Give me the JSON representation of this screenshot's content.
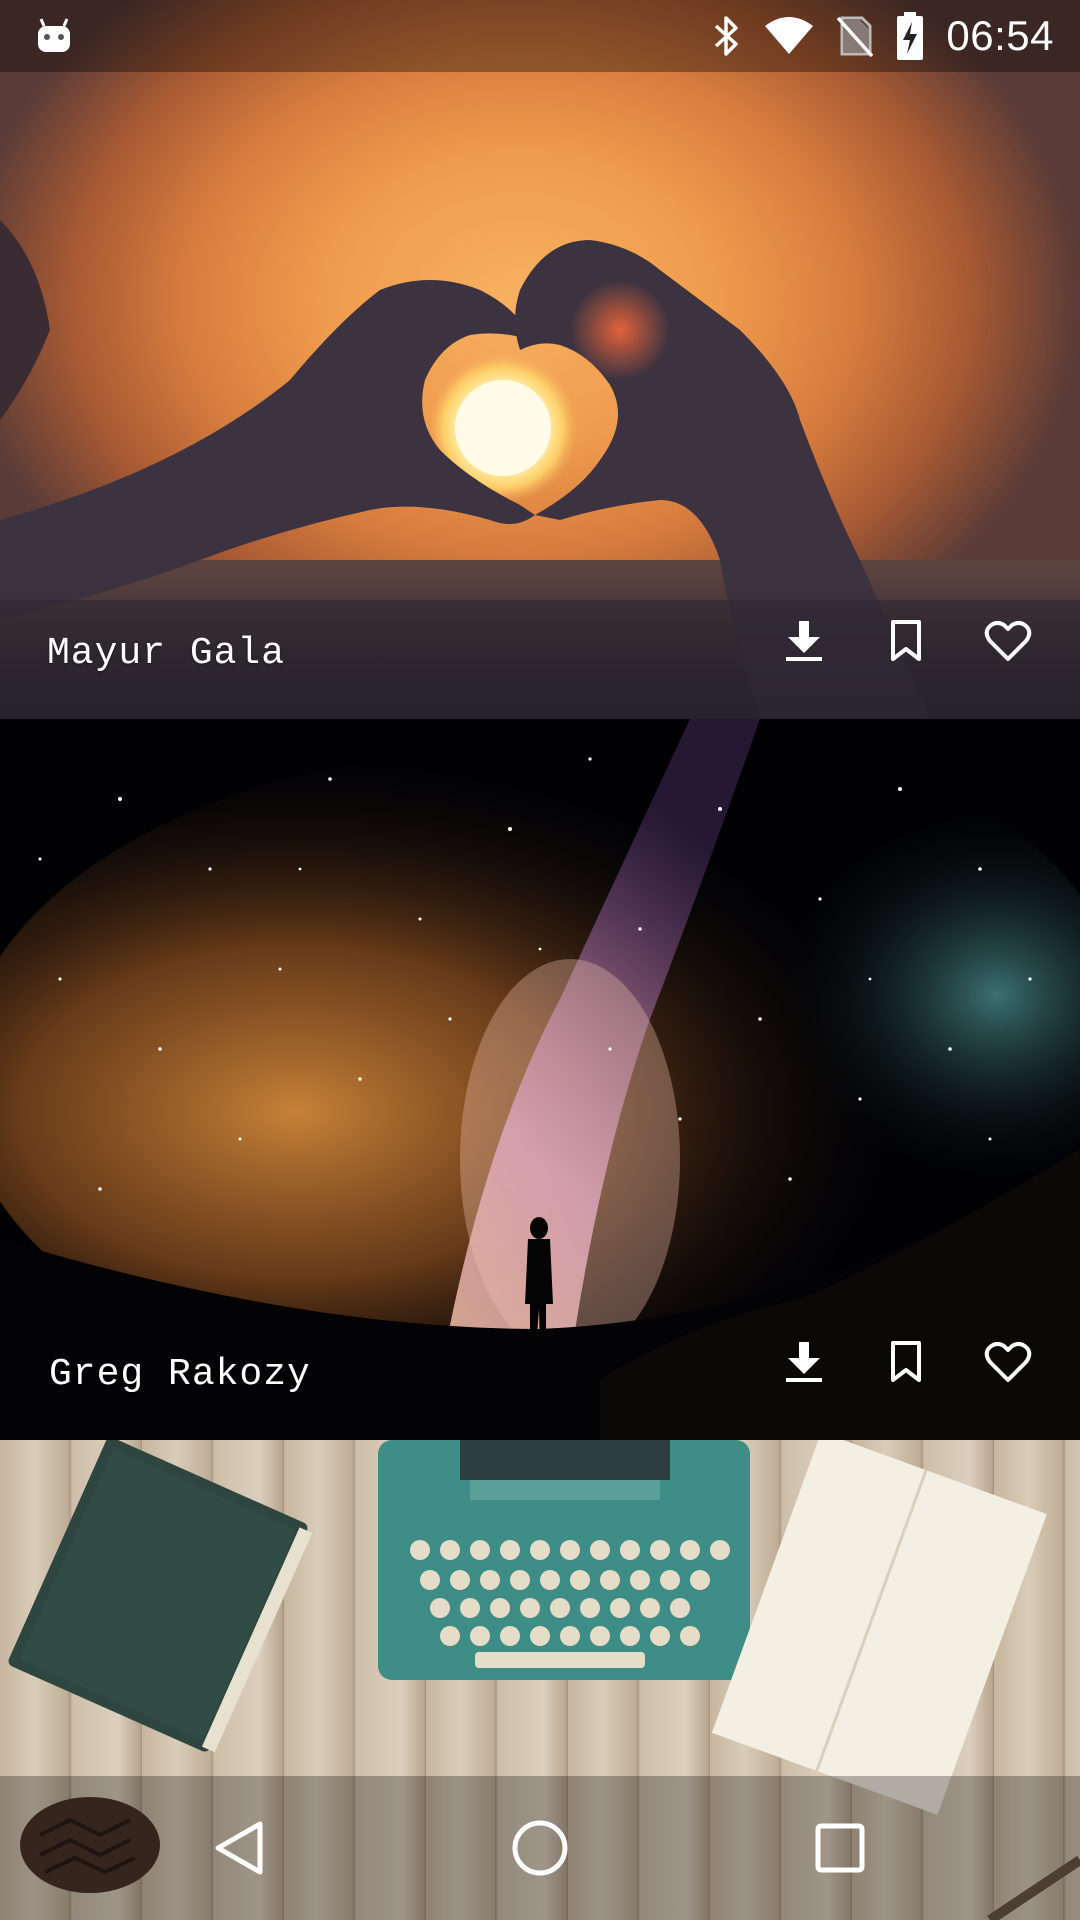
{
  "status_bar": {
    "time": "06:54",
    "icons": [
      "android-notification-icon",
      "bluetooth-icon",
      "wifi-icon",
      "no-sim-icon",
      "battery-charging-icon"
    ]
  },
  "feed": {
    "photos": [
      {
        "author": "Mayur Gala",
        "subject": "sunset heart hands",
        "actions": [
          "download-icon",
          "bookmark-icon",
          "heart-icon"
        ]
      },
      {
        "author": "Greg Rakozy",
        "subject": "milky way night sky",
        "actions": [
          "download-icon",
          "bookmark-icon",
          "heart-icon"
        ]
      },
      {
        "author": "",
        "subject": "typewriter on wooden desk",
        "actions": []
      }
    ]
  },
  "nav_bar": {
    "buttons": [
      "back-icon",
      "home-icon",
      "recent-apps-icon"
    ]
  },
  "colors": {
    "icon": "#ffffff",
    "status_bar_bg": "rgba(0,0,0,0.35)",
    "sunset_orange": "#ef9b4d",
    "night_sky": "#020205",
    "wood": "#c7b69f"
  }
}
